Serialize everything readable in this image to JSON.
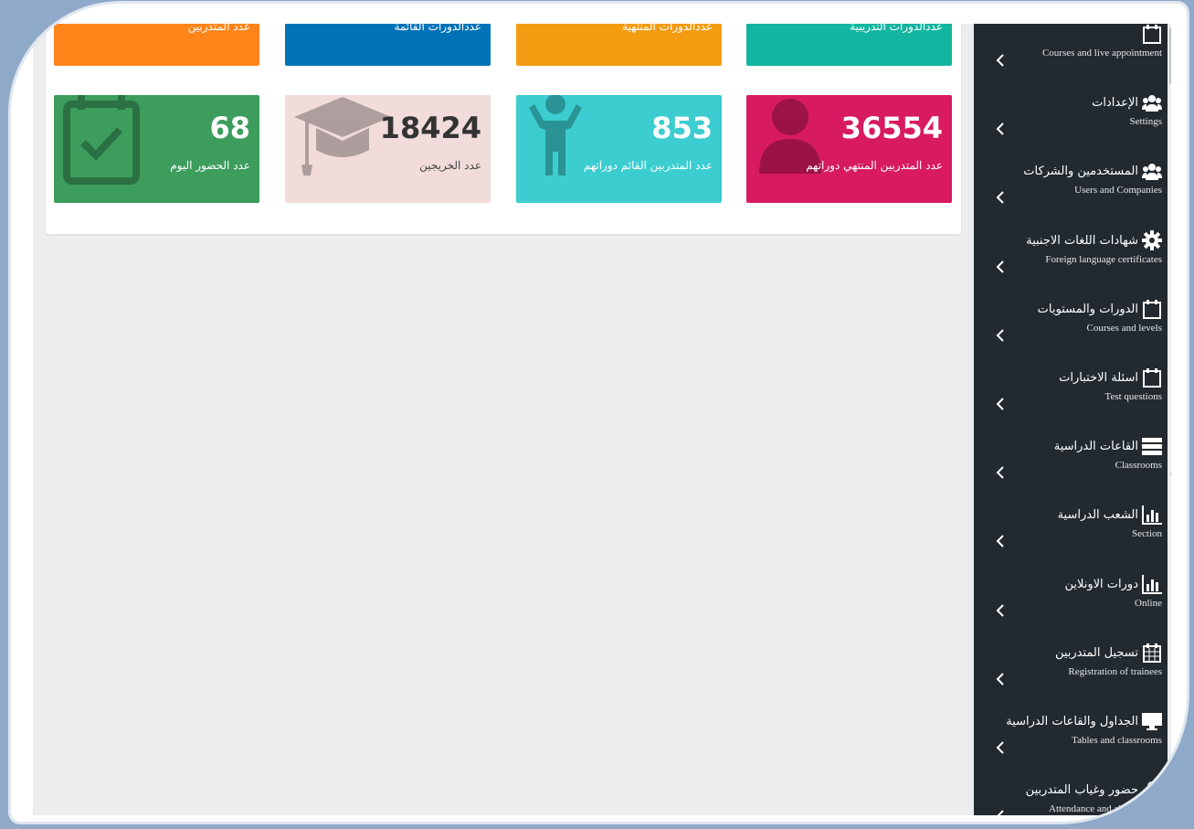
{
  "colors": {
    "orange": "#ff851b",
    "blue": "#0073b7",
    "amber": "#f39c12",
    "teal": "#12b5a0",
    "green": "#3c9d5d",
    "pink": "#f1dbdb",
    "cyan": "#3ccdd0",
    "crimson": "#d81b60",
    "sidebar": "#22292f"
  },
  "tiles_top": [
    {
      "label": "عدد المتدربين"
    },
    {
      "label": "عددالدورات القائمة"
    },
    {
      "label": "عددالدورات المنتهية"
    },
    {
      "label": "عددالدورات التدريبية"
    }
  ],
  "tiles": [
    {
      "value": "68",
      "label": "عدد الحضور اليوم",
      "icon": "calendar-check-icon"
    },
    {
      "value": "18424",
      "label": "عدد الخريجين",
      "icon": "graduation-cap-icon"
    },
    {
      "value": "853",
      "label": "عدد المتدربين القائم دوراتهم",
      "icon": "child-icon"
    },
    {
      "value": "36554",
      "label": "عدد المتدربين المنتهي دوراتهم",
      "icon": "user-icon"
    }
  ],
  "sidebar": {
    "items": [
      {
        "ar": "",
        "en": "Courses and live appointment",
        "icon": "calendar-icon"
      },
      {
        "ar": "الإعدادات",
        "en": "Settings",
        "icon": "users-icon"
      },
      {
        "ar": "المستخدمين والشركات",
        "en": "Users and Companies",
        "icon": "users-icon"
      },
      {
        "ar": "شهادات اللغات الاجنبية",
        "en": "Foreign language certificates",
        "icon": "gear-icon"
      },
      {
        "ar": "الدورات والمستويات",
        "en": "Courses and levels",
        "icon": "calendar-icon"
      },
      {
        "ar": "اسئلة الاختبارات",
        "en": "Test questions",
        "icon": "calendar-icon"
      },
      {
        "ar": "القاعات الدراسية",
        "en": "Classrooms",
        "icon": "server-icon"
      },
      {
        "ar": "الشعب الدراسية",
        "en": "Section",
        "icon": "bar-chart-icon"
      },
      {
        "ar": "دورات الاونلاين",
        "en": "Online",
        "icon": "bar-chart-icon"
      },
      {
        "ar": "تسجيل المتدربين",
        "en": "Registration of trainees",
        "icon": "calendar-grid-icon"
      },
      {
        "ar": "الجداول والقاعات الدراسية",
        "en": "Tables and classrooms",
        "icon": "monitor-icon"
      },
      {
        "ar": "حضور وغياب المتدربين",
        "en": "Attendance and absence of t",
        "icon": "user-icon"
      }
    ]
  }
}
